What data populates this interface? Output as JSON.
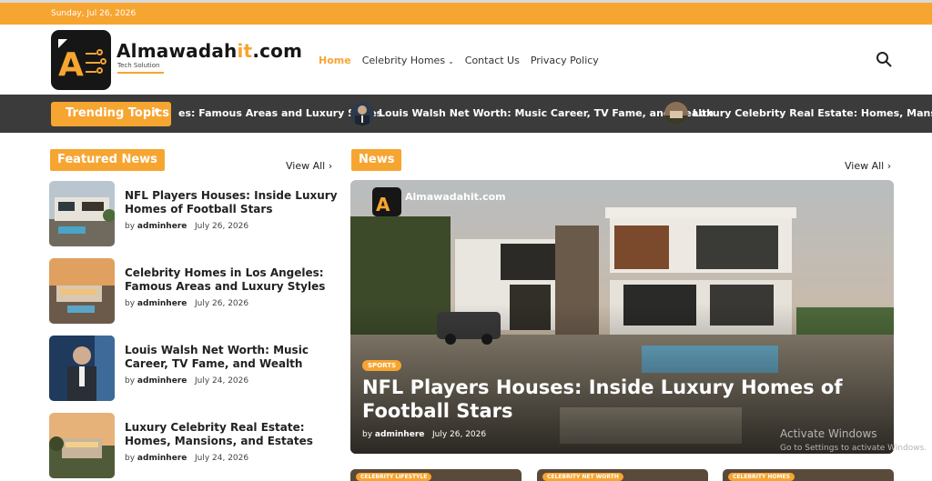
{
  "topbar": {
    "date": "Sunday, Jul 26, 2026"
  },
  "brand": {
    "name_prefix": "Almawadah",
    "name_highlight": "it",
    "name_suffix": ".com",
    "tagline": "Tech Solution"
  },
  "nav": {
    "items": [
      "Home",
      "Celebrity Homes",
      "Contact Us",
      "Privacy Policy"
    ],
    "active": "Home"
  },
  "ticker": {
    "label": "Trending Topics",
    "items": [
      "es: Famous Areas and Luxury Styles",
      "Louis Walsh Net Worth: Music Career, TV Fame, and Wealth",
      "Luxury Celebrity Real Estate: Homes, Mansi"
    ]
  },
  "featured": {
    "heading": "Featured News",
    "view_all": "View All",
    "items": [
      {
        "title": "NFL Players Houses: Inside Luxury Homes of Football Stars",
        "by": "by",
        "author": "adminhere",
        "date": "July 26, 2026"
      },
      {
        "title": "Celebrity Homes in Los Angeles: Famous Areas and Luxury Styles",
        "by": "by",
        "author": "adminhere",
        "date": "July 26, 2026"
      },
      {
        "title": "Louis Walsh Net Worth: Music Career, TV Fame, and Wealth",
        "by": "by",
        "author": "adminhere",
        "date": "July 24, 2026"
      },
      {
        "title": "Luxury Celebrity Real Estate: Homes, Mansions, and Estates",
        "by": "by",
        "author": "adminhere",
        "date": "July 24, 2026"
      }
    ]
  },
  "news": {
    "heading": "News",
    "view_all": "View All",
    "hero": {
      "badge": "SPORTS",
      "title": "NFL Players Houses: Inside Luxury Homes of Football Stars",
      "by": "by",
      "author": "adminhere",
      "date": "July 26, 2026",
      "watermark": "Almawadahit.com"
    },
    "cards": [
      "CELEBRITY LIFESTYLE",
      "CELEBRITY NET WORTH",
      "CELEBRITY HOMES"
    ]
  },
  "os_overlay": {
    "line1": "Activate Windows",
    "line2": "Go to Settings to activate Windows."
  },
  "colors": {
    "accent": "#f7a531",
    "ticker_bg": "#3b3b3b",
    "text": "#222222"
  }
}
